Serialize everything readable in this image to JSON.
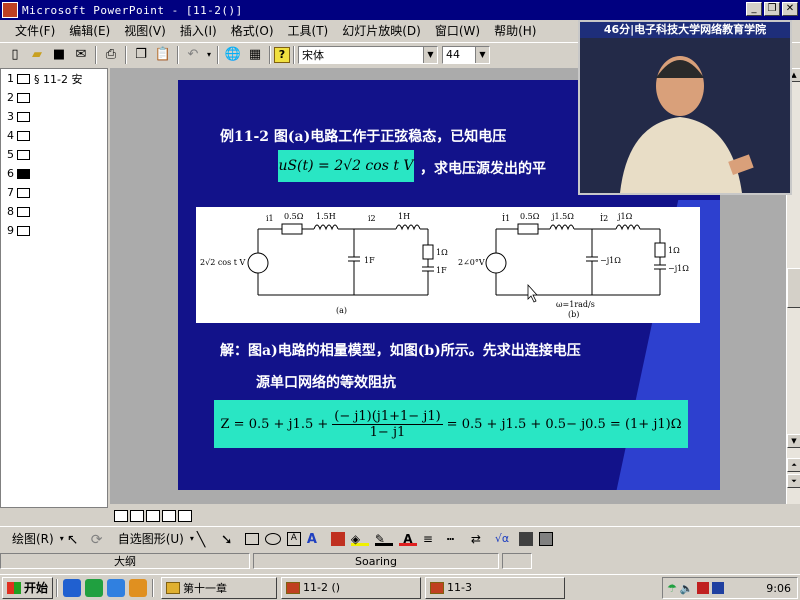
{
  "window": {
    "title": "Microsoft PowerPoint - [11-2()]"
  },
  "menu": [
    "文件(F)",
    "编辑(E)",
    "视图(V)",
    "插入(I)",
    "格式(O)",
    "工具(T)",
    "幻灯片放映(D)",
    "窗口(W)",
    "帮助(H)"
  ],
  "toolbar": {
    "font_name": "宋体",
    "font_size": "44"
  },
  "outline": {
    "items": [
      {
        "num": "1",
        "label": "§ 11-2  安"
      },
      {
        "num": "2",
        "label": ""
      },
      {
        "num": "3",
        "label": ""
      },
      {
        "num": "4",
        "label": ""
      },
      {
        "num": "5",
        "label": ""
      },
      {
        "num": "6",
        "label": ""
      },
      {
        "num": "7",
        "label": ""
      },
      {
        "num": "8",
        "label": ""
      },
      {
        "num": "9",
        "label": ""
      }
    ],
    "selected_index": 5
  },
  "slide": {
    "example_title": "例11-2   图(a)电路工作于正弦稳态，已知电压",
    "given_formula": "uS(t) = 2√2 cos t V",
    "question": "，求电压源发出的平",
    "solution_line1": "解：图a)电路的相量模型，如图(b)所示。先求出连接电压",
    "solution_line2": "源单口网络的等效阻抗",
    "impedance_formula": "Z = 0.5 + j1.5 + (−j1)(j1+1−j1)/(1−j1) = 0.5 + j1.5 + 0.5 − j0.5 = (1+j1)Ω",
    "impedance_lhs": "Z = 0.5 + j1.5 +",
    "impedance_num": "(− j1)(j1+1− j1)",
    "impedance_den": "1− j1",
    "impedance_rhs": "= 0.5 + j1.5 + 0.5− j0.5 = (1+ j1)Ω",
    "circuit_a": {
      "source": "2√2 cos t V",
      "i1": "i1",
      "i2": "i2",
      "r1": "0.5Ω",
      "l1": "1.5H",
      "l2": "1H",
      "c1": "1F",
      "r2": "1Ω",
      "c2": "1F",
      "caption": "(a)"
    },
    "circuit_b": {
      "source": "2∠0°V",
      "i1": "İ1",
      "i2": "İ2",
      "r1": "0.5Ω",
      "l1": "j1.5Ω",
      "l2": "j1Ω",
      "c1": "−j1Ω",
      "r2": "1Ω",
      "c2": "−j1Ω",
      "omega": "ω=1rad/s",
      "caption": "(b)"
    }
  },
  "webcam": {
    "caption": "46分|电子科技大学网络教育学院"
  },
  "drawbar": {
    "draw_label": "绘图(R)",
    "autoshapes_label": "自选图形(U)"
  },
  "statusbar": {
    "panel1": "大纲",
    "panel2": "Soaring"
  },
  "taskbar": {
    "start_label": "开始",
    "tasks": [
      "第十一章",
      "11-2 ()",
      "11-3"
    ],
    "clock": "9:06"
  }
}
